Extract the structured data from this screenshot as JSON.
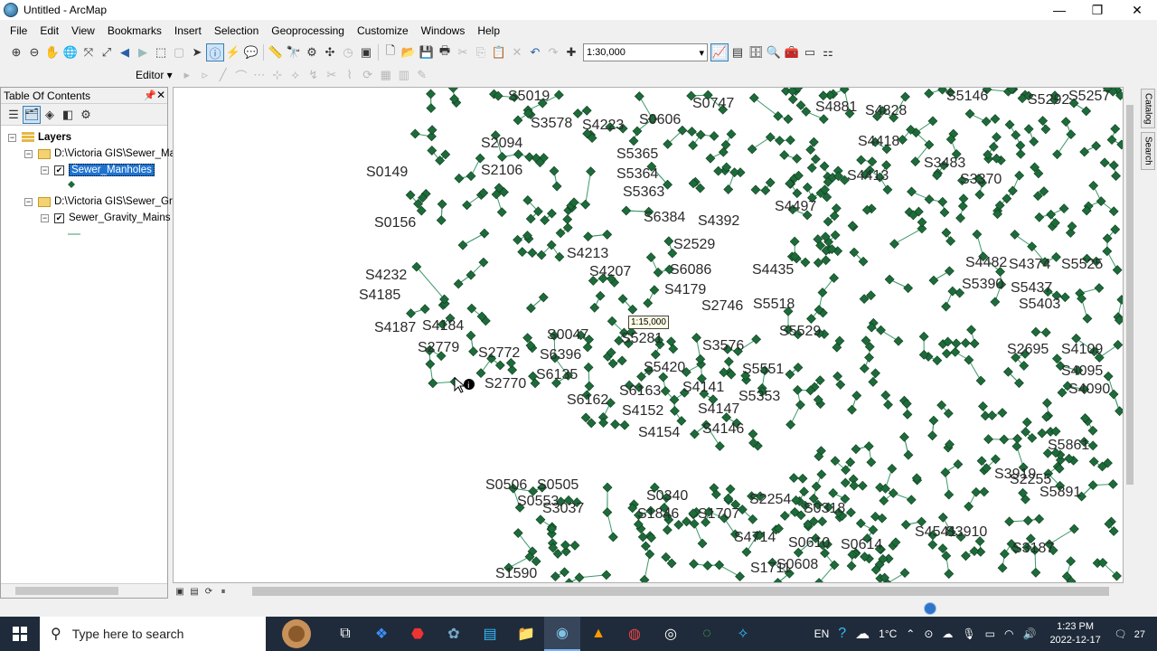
{
  "window": {
    "title": "Untitled - ArcMap",
    "min": "—",
    "restore": "❐",
    "close": "✕"
  },
  "menu": [
    "File",
    "Edit",
    "View",
    "Bookmarks",
    "Insert",
    "Selection",
    "Geoprocessing",
    "Customize",
    "Windows",
    "Help"
  ],
  "toolbar": {
    "scale": "1:30,000",
    "editor": "Editor ▾"
  },
  "toc": {
    "title": "Table Of Contents",
    "root": "Layers",
    "groups": [
      {
        "path": "D:\\Victoria GIS\\Sewer_Ma",
        "layer": "Sewer_Manholes",
        "checked": true,
        "selected": true
      },
      {
        "path": "D:\\Victoria GIS\\Sewer_Gra",
        "layer": "Sewer_Gravity_Mains",
        "checked": true,
        "selected": false
      }
    ]
  },
  "map": {
    "tooltip": "1:15,000",
    "point_color": "#1e6b3a",
    "line_color": "#3d9a6a",
    "labels": [
      "S5019",
      "S3578",
      "S4223",
      "S0606",
      "S0747",
      "S4881",
      "S4828",
      "S5146",
      "S5292",
      "S5257",
      "S2094",
      "S5365",
      "S5364",
      "S5363",
      "S0149",
      "S2106",
      "S6384",
      "S4392",
      "S4497",
      "S4418",
      "S4413",
      "S0156",
      "S4232",
      "S4185",
      "S4187",
      "S4184",
      "S2779",
      "S2772",
      "S2770",
      "S6135",
      "S6396",
      "S0047",
      "S5281",
      "S6086",
      "S2529",
      "S4435",
      "S4482",
      "S5525",
      "S5403",
      "S5390",
      "S2746",
      "S5518",
      "S5529",
      "S3576",
      "S5551",
      "S4179",
      "S4141",
      "S4147",
      "S4146",
      "S4154",
      "S4152",
      "S5420",
      "S6162",
      "S6163",
      "S4207",
      "S4213",
      "S5353",
      "S2695",
      "S4095",
      "S4109",
      "S4090",
      "S0506",
      "S0505",
      "S3037",
      "S0340",
      "S1707",
      "S1846",
      "S2254",
      "S0318",
      "S4714",
      "S0610",
      "S0614",
      "S0608",
      "S1711",
      "S1590",
      "S0553",
      "S3919",
      "S3187",
      "S4541",
      "S3910",
      "S2255",
      "S5891",
      "S5861",
      "S4374",
      "S5437",
      "S3370",
      "S3483"
    ]
  },
  "taskbar": {
    "search": "Type here to search",
    "lang": "EN",
    "temp": "1°C",
    "time": "1:23 PM",
    "date": "2022-12-17",
    "notif": "27"
  }
}
